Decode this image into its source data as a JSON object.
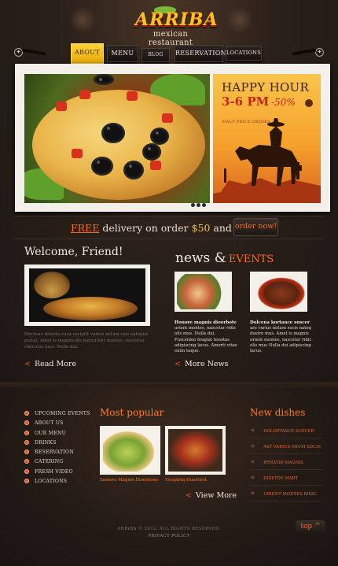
{
  "logo": {
    "brand": "ARRIBA",
    "subtitle": "mexican restaurant"
  },
  "nav": {
    "items": [
      {
        "label": "ABOUT US",
        "active": true
      },
      {
        "label": "MENU"
      },
      {
        "label": "BLOG"
      },
      {
        "label": "RESERVATION"
      },
      {
        "label": "LOCATIONS"
      }
    ]
  },
  "slider": {
    "ad_title": "HAPPY HOUR",
    "ad_time": "3-6 PM",
    "ad_discount": "-50%",
    "ad_sub": "HALF PRICE DRINKS"
  },
  "promo": {
    "free": "FREE",
    "before_amount": " delivery on order ",
    "amount": "$50",
    "after_amount": " and more!",
    "button": "order now!"
  },
  "welcome": {
    "title": "Welcome, Friend!",
    "text": "Mortaue delerta cusa sociptit varius mitum sols natoque pultat. Amet is magnis dis parturient montes, nascetur ridiculus mus. Nulla dui.",
    "read_more": "Read More"
  },
  "news": {
    "title": "news",
    "amp": "&",
    "events": "EVENTS",
    "items": [
      {
        "title": "Honore magnis dioorbote",
        "text": "urient montes, nascetur ridic olis mus. Nulla dui. Fusceideo feugiat tessitas adipiscing lacus. Amorti vitae enim tuque."
      },
      {
        "title": "Dolcena kortance suscer",
        "text": "are varius mitum socis natoq duelre mus. Amet is magnis urient montes, nascetur ridic olis mus Nulla dui adipiscing lacus."
      }
    ],
    "more": "More News"
  },
  "footer": {
    "menu": [
      "UPCOMING EVENTS",
      "ABOUT US",
      "OUR MENU",
      "DRINKS",
      "RESERVATION",
      "CATERING",
      "FRESH VIDEO",
      "LOCATIONS"
    ],
    "popular_title": "Most popular",
    "popular": [
      {
        "caption": "Samero Magnis Dioornoso"
      },
      {
        "caption": "Yroqsbtq Huartirst"
      }
    ],
    "view_more": "View More",
    "new_dishes_title": "New dishes",
    "new_dishes": [
      "DOLORTASCE SUSCER",
      "AST VARIUS MIUM SOCIS",
      "PENATIB MAGNIS",
      "DISETDE MART",
      "URIENT MONTES RIDIC"
    ],
    "copyright": "ARRIBA © 2012. ALL RIGHTS RESERVED.",
    "privacy": "PRIVACY POLICY",
    "top": "top"
  },
  "colors": {
    "accent": "#ff6a1a",
    "gold": "#ffc21a",
    "background": "#1c1612"
  }
}
